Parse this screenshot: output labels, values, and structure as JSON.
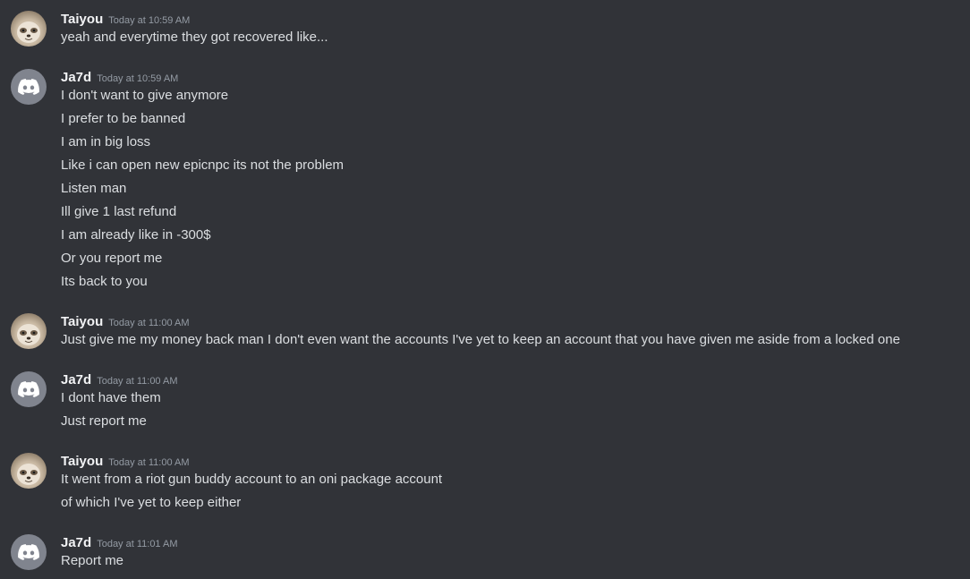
{
  "messages": [
    {
      "author": "Taiyou",
      "timestamp": "Today at 10:59 AM",
      "avatar": "sloth-photo",
      "lines": [
        "yeah and everytime they got recovered like..."
      ]
    },
    {
      "author": "Ja7d",
      "timestamp": "Today at 10:59 AM",
      "avatar": "discord-logo",
      "lines": [
        "I don't want to give anymore",
        "I prefer to be banned",
        "I am in big loss",
        "Like i can open new epicnpc its not the problem",
        "Listen man",
        "Ill give 1 last refund",
        "I am already like in -300$",
        "Or you report me",
        "Its back to you"
      ]
    },
    {
      "author": "Taiyou",
      "timestamp": "Today at 11:00 AM",
      "avatar": "sloth-photo",
      "lines": [
        "Just give me my money back man I don't even want the accounts I've yet to keep an account that you have given me aside from a locked one"
      ]
    },
    {
      "author": "Ja7d",
      "timestamp": "Today at 11:00 AM",
      "avatar": "discord-logo",
      "lines": [
        "I dont have them",
        "Just report me"
      ]
    },
    {
      "author": "Taiyou",
      "timestamp": "Today at 11:00 AM",
      "avatar": "sloth-photo",
      "lines": [
        "It went from a riot gun buddy account to an oni package account",
        "of which I've yet to keep either"
      ]
    },
    {
      "author": "Ja7d",
      "timestamp": "Today at 11:01 AM",
      "avatar": "discord-logo",
      "lines": [
        "Report me"
      ]
    }
  ],
  "colors": {
    "background": "#313338",
    "text": "#dbdee1",
    "username": "#f2f3f5",
    "timestamp": "#949ba4",
    "discord_avatar": "#80848e"
  }
}
